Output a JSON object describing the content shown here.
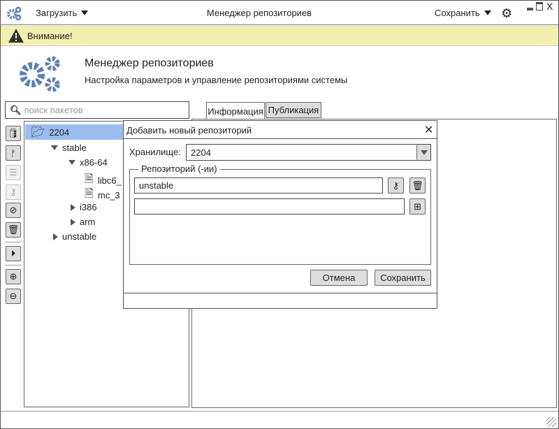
{
  "titlebar": {
    "load_label": "Загрузить",
    "title": "Менеджер репозиториев",
    "save_label": "Сохранить"
  },
  "warning": {
    "text": "Внимание!"
  },
  "header": {
    "title": "Менеджер репозиториев",
    "subtitle": "Настройка параметров и управление репозиториями системы"
  },
  "search": {
    "placeholder": "поиск пакетов"
  },
  "tabs": [
    {
      "label": "Информация",
      "active": true
    },
    {
      "label": "Публикация",
      "active": false
    }
  ],
  "tree": {
    "root": "2204",
    "stable": "stable",
    "arch1": "x86-64",
    "file1": "libc6_",
    "file2": "mc_3",
    "arch2": "i386",
    "arch3": "arm",
    "unstable": "unstable"
  },
  "dialog": {
    "title": "Добавить новый репозиторий",
    "storage_label": "Хранилище:",
    "storage_value": "2204",
    "group_label": "Репозиторий (-ии)",
    "repo1": "unstable",
    "repo2": "",
    "cancel": "Отмена",
    "save": "Сохранить"
  },
  "colors": {
    "accent": "#5a80b0",
    "selection": "#9bbdf0",
    "warning_bg": "#f3efb0"
  }
}
